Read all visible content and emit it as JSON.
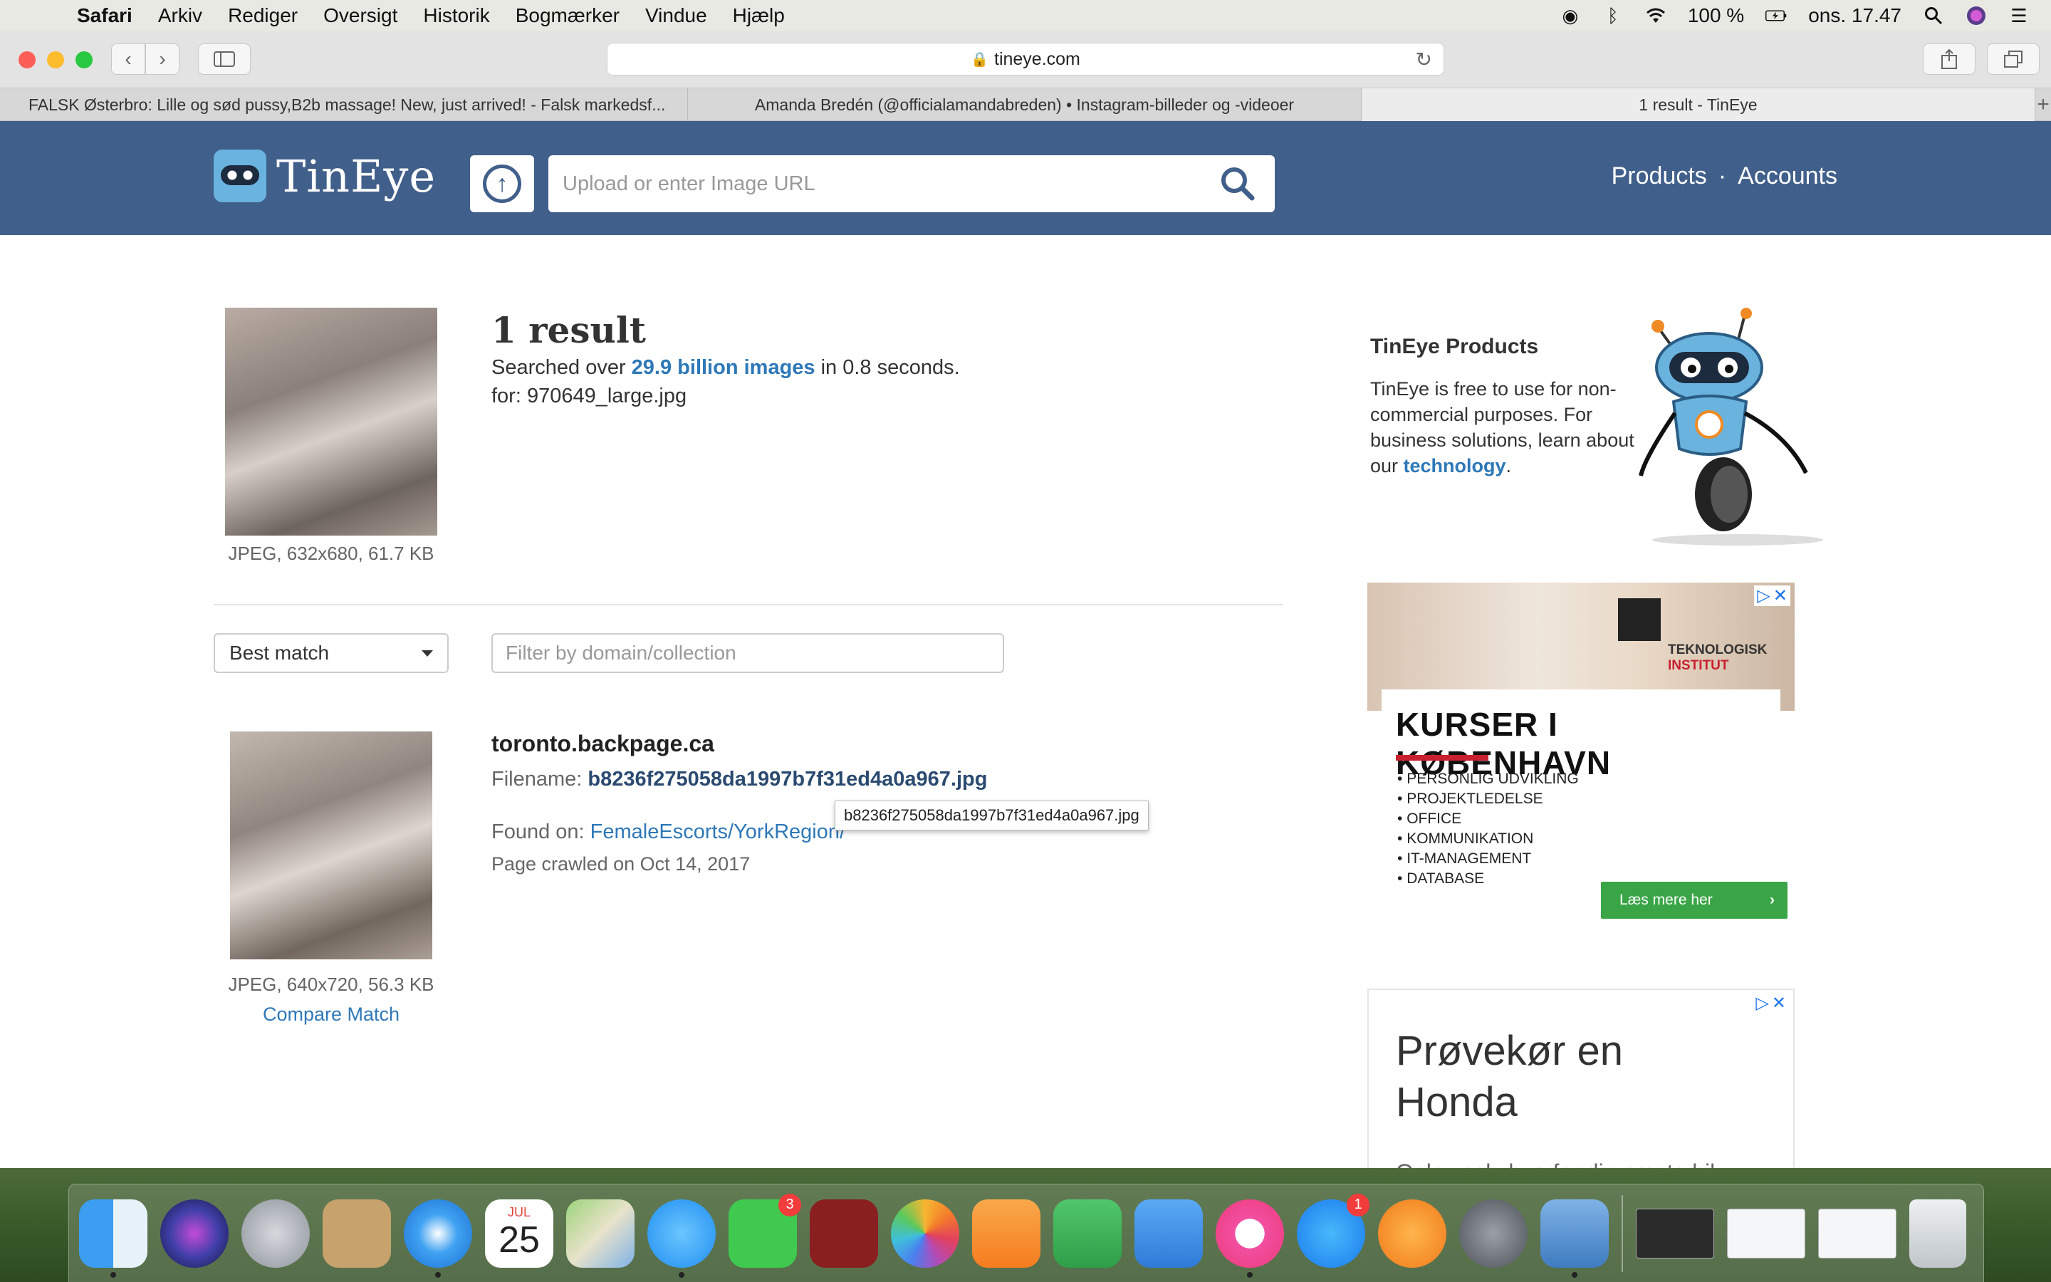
{
  "menubar": {
    "app": "Safari",
    "items": [
      "Arkiv",
      "Rediger",
      "Oversigt",
      "Historik",
      "Bogmærker",
      "Vindue",
      "Hjælp"
    ],
    "battery": "100 %",
    "clock": "ons. 17.47"
  },
  "browser": {
    "url": "tineye.com",
    "tabs": [
      "FALSK Østerbro: Lille og sød pussy,B2b massage! New, just arrived! - Falsk markedsf...",
      "Amanda Bredén (@officialamandabreden) • Instagram-billeder og -videoer",
      "1 result - TinEye"
    ],
    "new_tab": "+"
  },
  "header": {
    "logo_text": "TinEye",
    "search_placeholder": "Upload or enter Image URL",
    "link_products": "Products",
    "link_separator": "·",
    "link_accounts": "Accounts"
  },
  "query": {
    "meta": "JPEG, 632x680, 61.7 KB",
    "result_count": "1 result",
    "searched_prefix": "Searched over ",
    "searched_link": "29.9 billion images",
    "searched_suffix": " in 0.8 seconds.",
    "for_line": "for: 970649_large.jpg"
  },
  "controls": {
    "sort_value": "Best match",
    "filter_placeholder": "Filter by domain/collection"
  },
  "match": {
    "domain": "toronto.backpage.ca",
    "filename_label": "Filename: ",
    "filename": "b8236f275058da1997b7f31ed4a0a967.jpg",
    "tooltip": "b8236f275058da1997b7f31ed4a0a967.jpg",
    "found_label": "Found on: ",
    "found_link": "FemaleEscorts/YorkRegion/",
    "crawled": "Page crawled on Oct 14, 2017",
    "meta": "JPEG, 640x720, 56.3 KB",
    "compare": "Compare Match"
  },
  "sidebar": {
    "title": "TinEye Products",
    "text_before": "TinEye is free to use for non-commercial purposes. For business solutions, learn about our ",
    "text_link": "technology",
    "text_after": "."
  },
  "ad1": {
    "brand_line1": "TEKNOLOGISK",
    "brand_line2": "INSTITUT",
    "headline": "KURSER I KØBENHAVN",
    "items": [
      "PERSONLIG UDVIKLING",
      "PROJEKTLEDELSE",
      "OFFICE",
      "KOMMUNIKATION",
      "IT-MANAGEMENT",
      "DATABASE"
    ],
    "cta": "Læs mere her"
  },
  "ad2": {
    "headline_line1": "Prøvekør en",
    "headline_line2": "Honda",
    "text": "Oplev selv hvorfor din næste bil"
  },
  "dock": {
    "calendar_month": "JUL",
    "calendar_day": "25",
    "facetime_badge": "3",
    "appstore_badge": "1"
  }
}
